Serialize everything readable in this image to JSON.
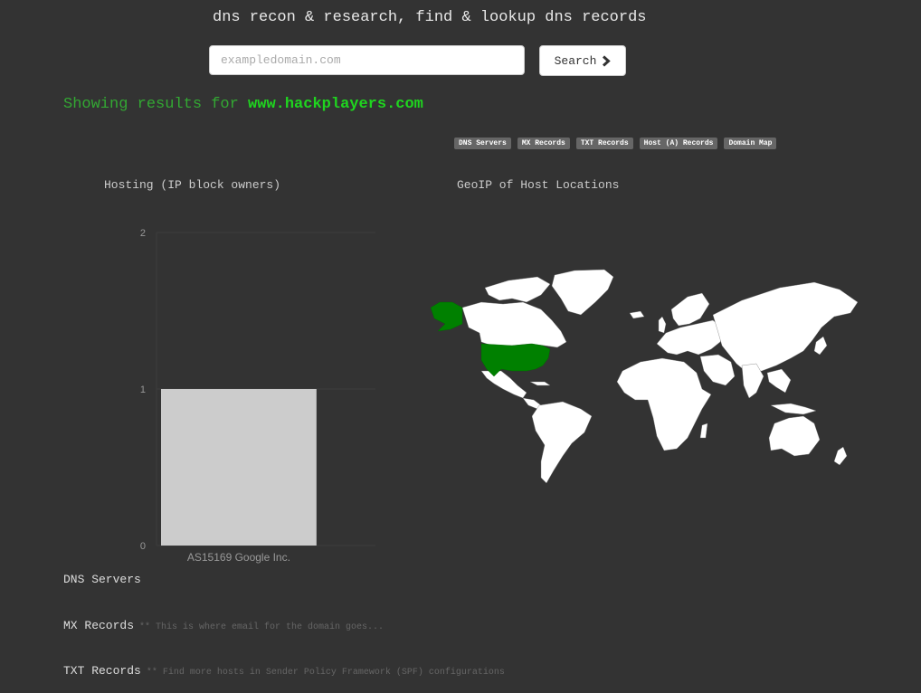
{
  "header": {
    "tagline": "dns recon & research, find & lookup dns records"
  },
  "search": {
    "placeholder": "exampledomain.com",
    "value": "",
    "button_label": "Search",
    "button_icon": "chevron-right-icon"
  },
  "results": {
    "prefix": "Showing results for ",
    "domain": "www.hackplayers.com"
  },
  "nav": {
    "items": [
      "DNS Servers",
      "MX Records",
      "TXT Records",
      "Host (A) Records",
      "Domain Map"
    ]
  },
  "hosting": {
    "title": "Hosting (IP block owners)"
  },
  "geoip": {
    "title": "GeoIP of Host Locations",
    "highlighted_country": "United States",
    "highlight_color": "#008000",
    "land_color": "#ffffff"
  },
  "chart_data": {
    "type": "bar",
    "categories": [
      "AS15169 Google Inc."
    ],
    "values": [
      1
    ],
    "ylim": [
      0,
      2
    ],
    "yticks": [
      0,
      1,
      2
    ],
    "grid": true,
    "bar_color": "#cccccc"
  },
  "records": {
    "dns": {
      "title": "DNS Servers",
      "note": ""
    },
    "mx": {
      "title": "MX Records",
      "note": "** This is where email for the domain goes..."
    },
    "txt": {
      "title": "TXT Records",
      "note": "** Find more hosts in Sender Policy Framework (SPF) configurations"
    }
  }
}
